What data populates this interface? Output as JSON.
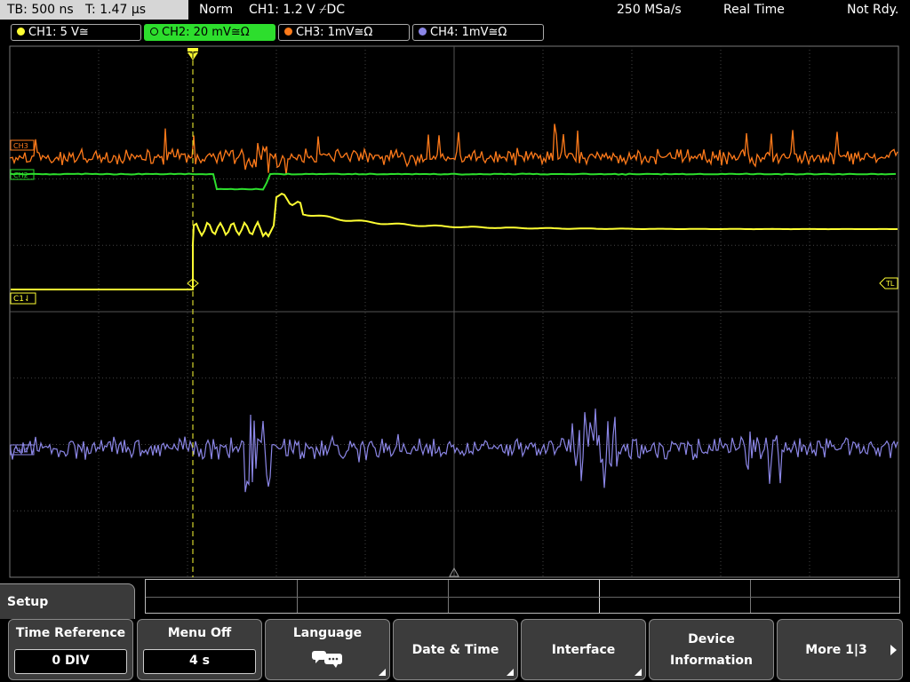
{
  "header": {
    "timebase": "TB: 500 ns   T: 1.47 µs",
    "mode": "Norm",
    "trigger": "CH1: 1.2 V ⌿DC",
    "sample_rate": "250 MSa/s",
    "acq_mode": "Real Time",
    "status": "Not Rdy."
  },
  "channels": [
    {
      "label": "CH1: 5 V≅",
      "color": "#ffff33"
    },
    {
      "label": "CH2: 20 mV≅Ω",
      "color": "#2dde2d",
      "active": true
    },
    {
      "label": "CH3: 1mV≅Ω",
      "color": "#ff7a1a"
    },
    {
      "label": "CH4: 1mV≅Ω",
      "color": "#8b86e6"
    }
  ],
  "markers": {
    "ch3": "CH3",
    "ch2": "CH2",
    "ch1": "C1⇃",
    "ch4": "CH4",
    "trigger_level": "TL",
    "trigger_pos": "T"
  },
  "menu": {
    "title": "Setup",
    "softkeys": [
      {
        "label": "Time Reference",
        "value": "0 DIV"
      },
      {
        "label": "Menu Off",
        "value": "4 s"
      },
      {
        "label": "Language",
        "icon": "speech-bubbles-icon"
      },
      {
        "label": "Date & Time"
      },
      {
        "label": "Interface"
      },
      {
        "label_line1": "Device",
        "label_line2": "Information"
      },
      {
        "label": "More 1|3"
      }
    ]
  },
  "colors": {
    "ch1": "#ffff33",
    "ch2": "#2dde2d",
    "ch3": "#ff7a1a",
    "ch4": "#8b86e6",
    "trigger": "#ffff33",
    "grid": "#555555"
  }
}
